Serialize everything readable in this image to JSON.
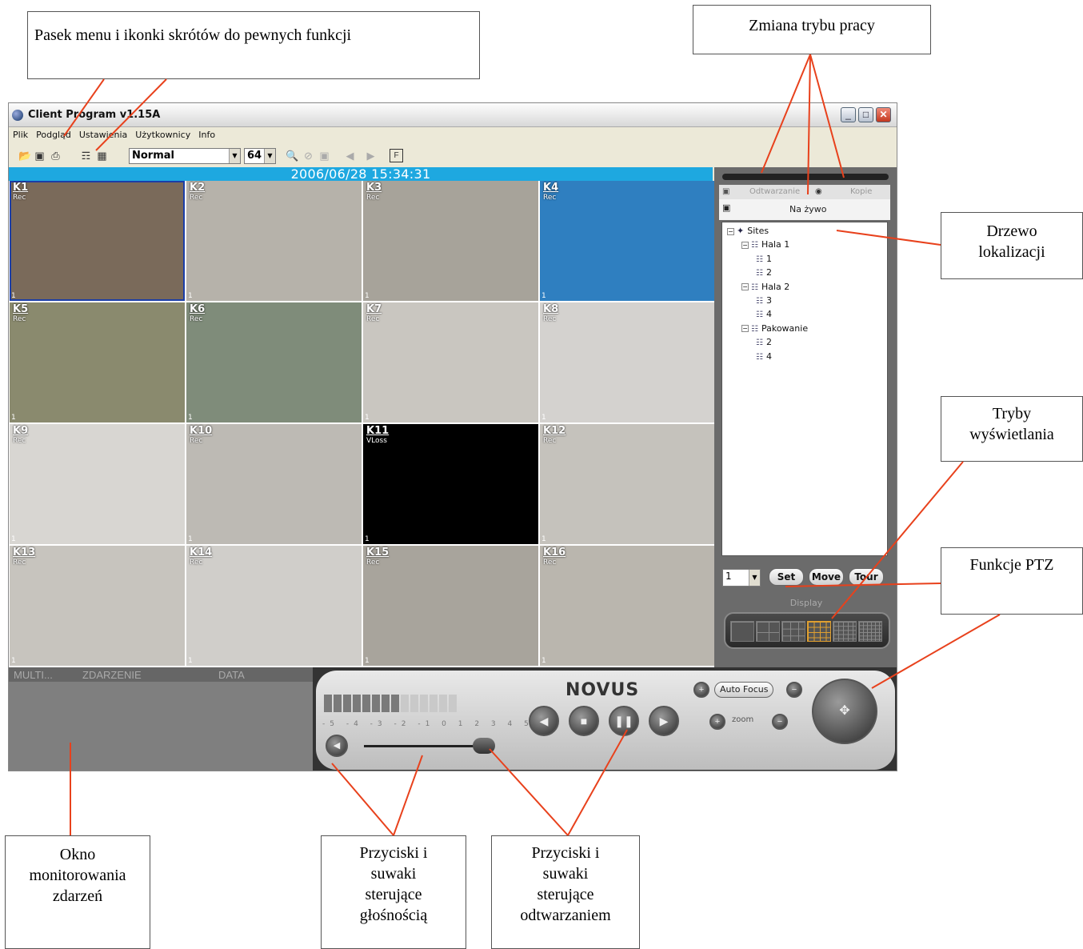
{
  "callouts": {
    "menu_bar": "Pasek menu i ikonki skrótów do pewnych funkcji",
    "mode_change": "Zmiana trybu pracy",
    "location_tree": "Drzewo lokalizacji",
    "display_modes": "Tryby wyświetlania",
    "ptz": "Funkcje PTZ",
    "event_window": "Okno monitorowania zdarzeń",
    "volume_controls": "Przyciski i suwaki sterujące głośnością",
    "playback_controls": "Przyciski i suwaki sterujące odtwarzaniem"
  },
  "window": {
    "title": "Client Program v1.15A",
    "minimize": "_",
    "maximize": "□",
    "close": "✕"
  },
  "menu": [
    "Plik",
    "Podgląd",
    "Ustawienia",
    "Użytkownicy",
    "Info"
  ],
  "toolbar": {
    "mode_select": "Normal",
    "count_select": "64",
    "icons": [
      "open-icon",
      "save-icon",
      "print-icon",
      "book-icon",
      "calculator-icon",
      "search-icon",
      "stop-icon",
      "export-icon",
      "prev-icon",
      "next-icon",
      "fullscreen-icon"
    ],
    "fullscreen_glyph": "F"
  },
  "datetime": "2006/06/28 15:34:31",
  "cameras": [
    {
      "label": "K1",
      "status": "Rec",
      "num": "1",
      "color": "#7a6a5a",
      "selected": true
    },
    {
      "label": "K2",
      "status": "Rec",
      "num": "1",
      "color": "#b6b2aa"
    },
    {
      "label": "K3",
      "status": "Rec",
      "num": "1",
      "color": "#a7a39a"
    },
    {
      "label": "K4",
      "status": "Rec",
      "num": "1",
      "color": "#2f7fc0"
    },
    {
      "label": "K5",
      "status": "Rec",
      "num": "1",
      "color": "#8a8a6e"
    },
    {
      "label": "K6",
      "status": "Rec",
      "num": "1",
      "color": "#7f8c7a"
    },
    {
      "label": "K7",
      "status": "Rec",
      "num": "1",
      "color": "#c9c6c0"
    },
    {
      "label": "K8",
      "status": "Rec",
      "num": "1",
      "color": "#d4d2cf"
    },
    {
      "label": "K9",
      "status": "Rec",
      "num": "1",
      "color": "#d8d6d2"
    },
    {
      "label": "K10",
      "status": "Rec",
      "num": "1",
      "color": "#bdbab4"
    },
    {
      "label": "K11",
      "status": "VLoss",
      "num": "1",
      "color": "#000000"
    },
    {
      "label": "K12",
      "status": "Rec",
      "num": "1",
      "color": "#c5c2bc"
    },
    {
      "label": "K13",
      "status": "Rec",
      "num": "1",
      "color": "#c7c4be"
    },
    {
      "label": "K14",
      "status": "Rec",
      "num": "1",
      "color": "#d0ceca"
    },
    {
      "label": "K15",
      "status": "Rec",
      "num": "1",
      "color": "#a8a49c"
    },
    {
      "label": "K16",
      "status": "Rec",
      "num": "1",
      "color": "#bab6ae"
    }
  ],
  "right_panel": {
    "tab_playback": "Odtwarzanie",
    "tab_backup": "Kopie",
    "live": "Na żywo",
    "tree": [
      {
        "label": "Sites",
        "level": 0
      },
      {
        "label": "Hala 1",
        "level": 1
      },
      {
        "label": "1",
        "level": 2
      },
      {
        "label": "2",
        "level": 2
      },
      {
        "label": "Hala 2",
        "level": 1
      },
      {
        "label": "3",
        "level": 2
      },
      {
        "label": "4",
        "level": 2
      },
      {
        "label": "Pakowanie",
        "level": 1
      },
      {
        "label": "2",
        "level": 2
      },
      {
        "label": "4",
        "level": 2
      }
    ],
    "ptz_select": "1",
    "set": "Set",
    "move": "Move",
    "tour": "Tour",
    "display_label": "Display",
    "display_modes": [
      "1x1",
      "2x2",
      "3x3",
      "4x4",
      "5x5",
      "6x6"
    ],
    "active_display": "4x4"
  },
  "events": {
    "columns": [
      "MULTI...",
      "ZDARZENIE",
      "DATA"
    ]
  },
  "controls": {
    "logo": "NOVUS",
    "auto_focus": "Auto Focus",
    "zoom": "zoom",
    "scale": "-5 -4 -3 -2 -1 0 1 2 3 4 5"
  }
}
